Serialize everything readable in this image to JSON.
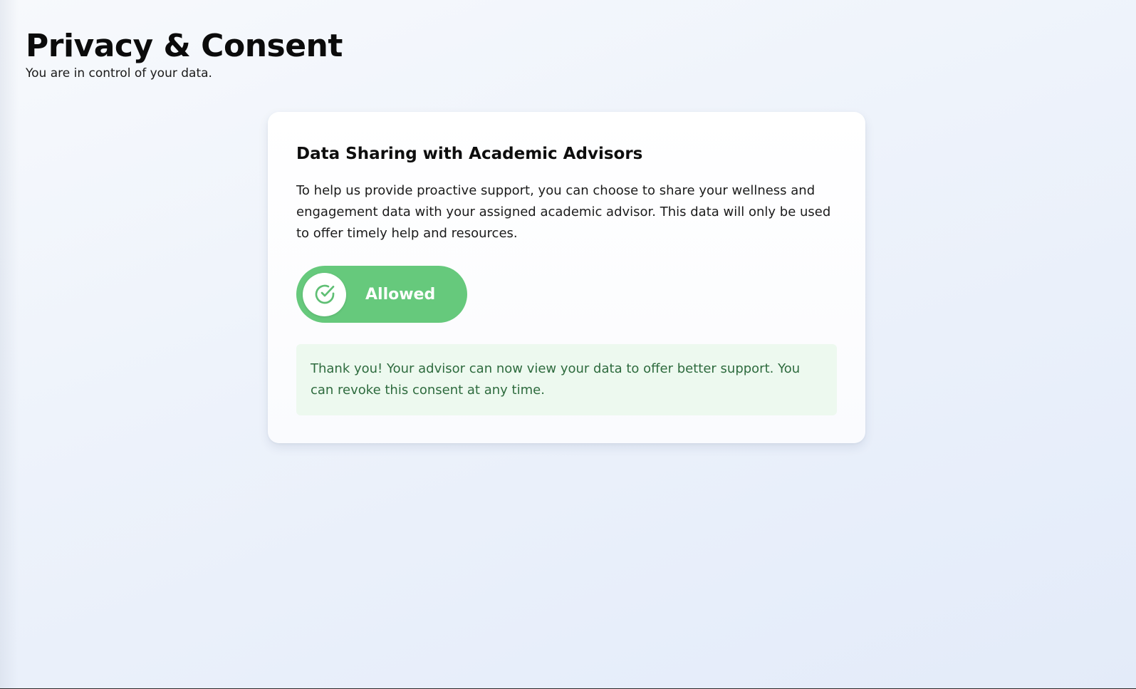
{
  "header": {
    "title": "Privacy & Consent",
    "subtitle": "You are in control of your data."
  },
  "consent_card": {
    "title": "Data Sharing with Academic Advisors",
    "description": "To help us provide proactive support, you can choose to share your wellness and engagement data with your assigned academic advisor. This data will only be used to offer timely help and resources.",
    "toggle": {
      "state": "on",
      "label": "Allowed",
      "icon": "check-circle-icon"
    },
    "notice": "Thank you! Your advisor can now view your data to offer better support. You can revoke this consent at any time."
  },
  "colors": {
    "toggle_on": "#66c97c",
    "notice_background": "#edf9ef",
    "notice_text": "#2e6b3e"
  }
}
